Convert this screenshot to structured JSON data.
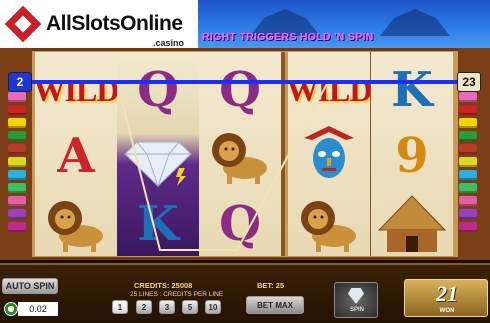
{
  "logo": {
    "title": "AllSlotsOnline",
    "subtitle": ".casino"
  },
  "banner": {
    "text": "RIGHT TRIGGERS HOLD 'N SPIN"
  },
  "paylines": {
    "left_number": "2",
    "right_number": "23"
  },
  "side_tab_colors": [
    "#e86ab8",
    "#cc2222",
    "#f2d400",
    "#2a9a3a",
    "#b83a2a",
    "#e0d820",
    "#2ab0e0",
    "#3ac060",
    "#e060a0",
    "#9a40c0",
    "#c02a8a"
  ],
  "reels": [
    [
      "WILD",
      "A",
      "lion"
    ],
    [
      "Q",
      "diamond",
      "K"
    ],
    [
      "Q",
      "lion",
      "Q"
    ],
    [
      "WILD",
      "mask",
      "lion"
    ],
    [
      "K",
      "9",
      "hut"
    ]
  ],
  "symbol_colors": {
    "A": "#c8262a",
    "K": "#1d6fb8",
    "Q": "#8a2c84",
    "9": "#d48a10"
  },
  "controls": {
    "auto_spin": "AUTO SPIN",
    "coin_value": "0.02",
    "credits": "CREDITS: 25008",
    "bet": "BET: 25",
    "lines_caption": "25 LINES : CREDITS PER LINE",
    "line_buttons": [
      "1",
      "2",
      "3",
      "5",
      "10"
    ],
    "bet_max": "BET MAX",
    "spin": "SPIN",
    "won_value": "21",
    "won_label": "WON"
  }
}
